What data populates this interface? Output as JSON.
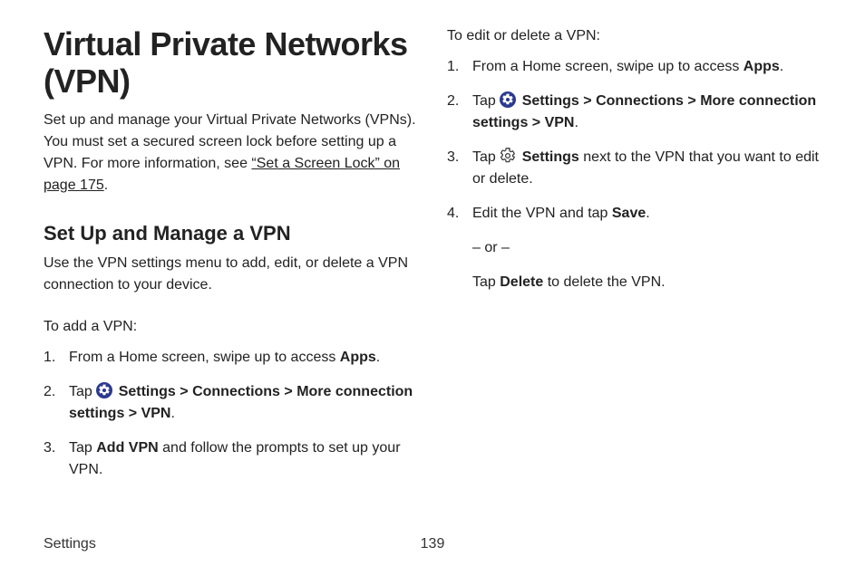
{
  "left": {
    "h1": "Virtual Private Networks (VPN)",
    "intro_a": "Set up and manage your Virtual Private Networks (VPNs). You must set a secured screen lock before setting up a VPN. For more information, see ",
    "intro_link": "“Set a Screen Lock” on page 175",
    "intro_b": ".",
    "h2": "Set Up and Manage a VPN",
    "subintro": "Use the VPN settings menu to add, edit, or delete a VPN connection to your device.",
    "lead": "To add a VPN:",
    "li1_a": "From a Home screen, swipe up to access ",
    "li1_b": "Apps",
    "li1_c": ".",
    "li2_a": "Tap ",
    "li2_b": "Settings",
    "li2_gt1": " > ",
    "li2_c": "Connections",
    "li2_gt2": " > ",
    "li2_d": "More connection settings",
    "li2_gt3": " > ",
    "li2_e": "VPN",
    "li2_f": ".",
    "li3_a": "Tap ",
    "li3_b": "Add VPN",
    "li3_c": " and follow the prompts to set up your VPN."
  },
  "right": {
    "lead": "To edit or delete a VPN:",
    "li1_a": "From a Home screen, swipe up to access ",
    "li1_b": "Apps",
    "li1_c": ".",
    "li2_a": "Tap ",
    "li2_b": "Settings",
    "li2_gt1": " > ",
    "li2_c": "Connections",
    "li2_gt2": " > ",
    "li2_d": "More connection settings",
    "li2_gt3": " > ",
    "li2_e": "VPN",
    "li2_f": ".",
    "li3_a": "Tap ",
    "li3_b": "Settings",
    "li3_c": " next to the VPN that you want to edit or delete.",
    "li4_a": "Edit the VPN and tap ",
    "li4_b": "Save",
    "li4_c": ".",
    "or": "– or –",
    "del_a": "Tap ",
    "del_b": "Delete",
    "del_c": " to delete the VPN."
  },
  "footer": {
    "section": "Settings",
    "page": "139"
  }
}
